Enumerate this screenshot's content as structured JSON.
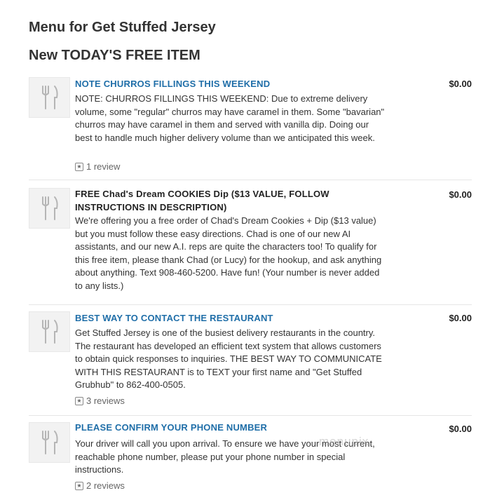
{
  "page": {
    "title": "Menu for Get Stuffed Jersey",
    "section_title": "New TODAY'S FREE ITEM"
  },
  "items": [
    {
      "name": "NOTE CHURROS FILLINGS THIS WEEKEND",
      "description": "NOTE: CHURROS FILLINGS THIS WEEKEND: Due to extreme delivery volume, some \"regular\" churros may have caramel in them. Some \"bavarian\" churros may have caramel in them and served with vanilla dip. Doing our best to handle much higher delivery volume than we anticipated this week.",
      "price": "$0.00",
      "reviews": "1 review"
    },
    {
      "name": "FREE Chad's Dream COOKIES Dip ($13 VALUE, FOLLOW INSTRUCTIONS IN DESCRIPTION)",
      "description": "We're offering you a free order of Chad's Dream Cookies + Dip ($13 value) but you must follow these easy directions. Chad is one of our new AI assistants, and our new A.I. reps are quite the characters too! To qualify for this free item, please thank Chad (or Lucy) for the hookup, and ask anything about anything. Text 908-460-5200. Have fun! (Your number is never added to any lists.)",
      "price": "$0.00"
    },
    {
      "name": "BEST WAY TO CONTACT THE RESTAURANT",
      "description": "Get Stuffed Jersey is one of the busiest delivery restaurants in the country. The restaurant has developed an efficient text system that allows customers to obtain quick responses to inquiries. THE BEST WAY TO COMMUNICATE WITH THIS RESTAURANT is to TEXT your first name and \"Get Stuffed Grubhub\" to 862-400-0505.",
      "price": "$0.00",
      "reviews": "3 reviews"
    },
    {
      "name": "PLEASE CONFIRM YOUR PHONE NUMBER",
      "description": "Your driver will call you upon arrival. To ensure we have your most current, reachable phone number, please put your phone number in special instructions.",
      "price": "$0.00",
      "reviews": "2 reviews"
    }
  ],
  "icons": {
    "thumbnail": "fork-knife-icon",
    "review": "star-box-icon"
  },
  "colors": {
    "link": "#1f6ea8",
    "thumbnail_bg": "#f2f2f2"
  },
  "watermark": "menupix"
}
